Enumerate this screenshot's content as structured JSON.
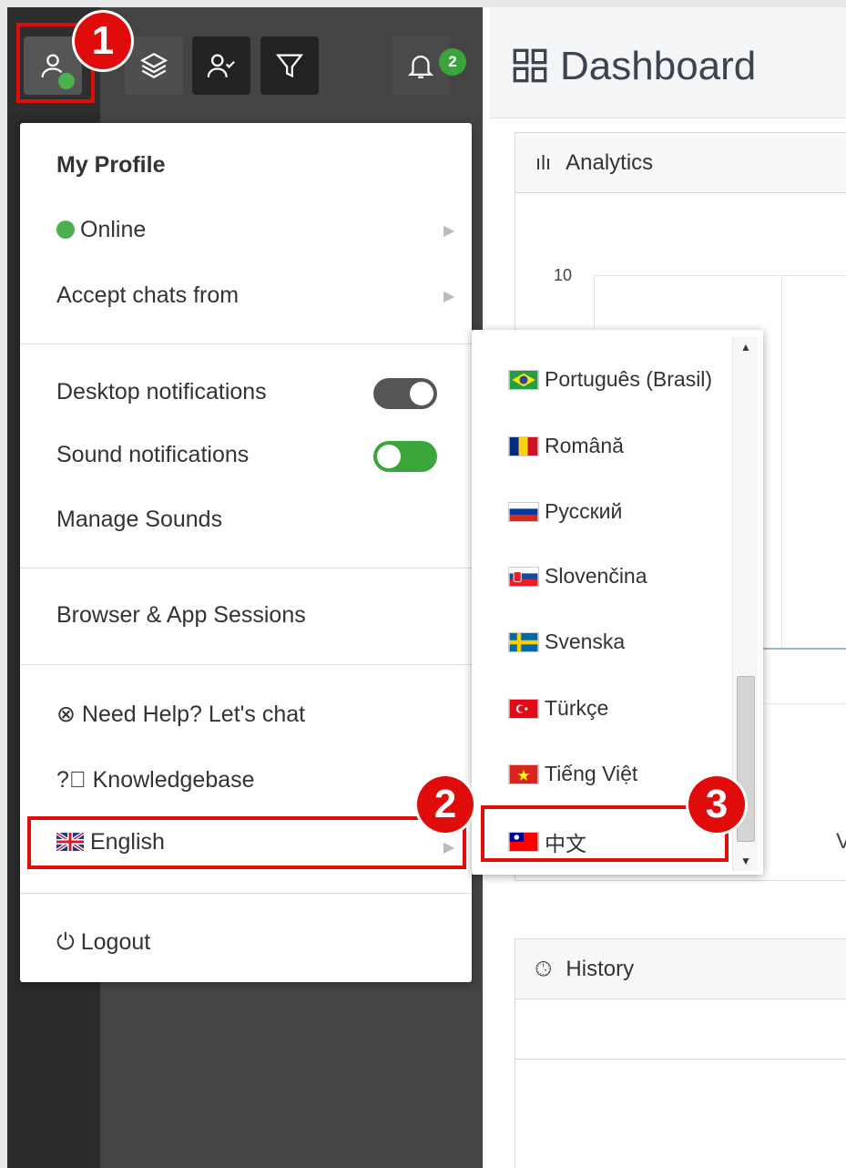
{
  "toolbar": {
    "notification_count": "2"
  },
  "dashboard": {
    "title": "Dashboard",
    "analytics_title": "Analytics",
    "analytics_axis_tick": "10",
    "history_title": "History",
    "partial_label": "V"
  },
  "profile_menu": {
    "my_profile": "My Profile",
    "status": "Online",
    "accept_chats": "Accept chats from",
    "desktop_notifications": "Desktop notifications",
    "sound_notifications": "Sound notifications",
    "manage_sounds": "Manage Sounds",
    "browser_sessions": "Browser & App Sessions",
    "need_help": "Need Help? Let's chat",
    "knowledgebase": "Knowledgebase",
    "language": "English",
    "logout": "Logout"
  },
  "languages": [
    {
      "label": "Português (Brasil)",
      "flag": "br"
    },
    {
      "label": "Română",
      "flag": "ro"
    },
    {
      "label": "Русский",
      "flag": "ru"
    },
    {
      "label": "Slovenčina",
      "flag": "sk"
    },
    {
      "label": "Svenska",
      "flag": "se"
    },
    {
      "label": "Türkçe",
      "flag": "tr"
    },
    {
      "label": "Tiếng Việt",
      "flag": "vn"
    },
    {
      "label": "中文",
      "flag": "tw"
    }
  ],
  "annotations": {
    "step1": "1",
    "step2": "2",
    "step3": "3"
  },
  "colors": {
    "annotation_red": "#e00b0b",
    "online_green": "#4caf50",
    "toggle_on": "#3aa53a",
    "toggle_off": "#555555"
  }
}
